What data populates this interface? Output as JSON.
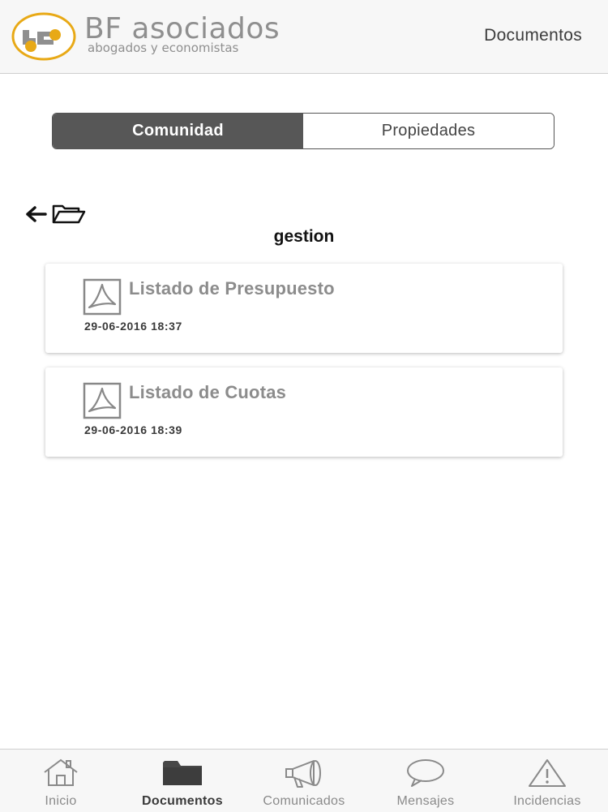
{
  "header": {
    "brand_name": "BF asociados",
    "brand_tagline": "abogados y economistas",
    "title": "Documentos"
  },
  "segmented": {
    "tabs": [
      {
        "label": "Comunidad",
        "active": true
      },
      {
        "label": "Propiedades",
        "active": false
      }
    ]
  },
  "folder": {
    "name": "gestion",
    "back_icon": "arrow-left-icon",
    "folder_icon": "folder-open-icon"
  },
  "documents": [
    {
      "title": "Listado de Presupuesto",
      "date": "29-06-2016 18:37",
      "icon": "pdf-icon"
    },
    {
      "title": "Listado de Cuotas",
      "date": "29-06-2016 18:39",
      "icon": "pdf-icon"
    }
  ],
  "tabbar": {
    "items": [
      {
        "label": "Inicio",
        "icon": "home-icon",
        "active": false
      },
      {
        "label": "Documentos",
        "icon": "folder-icon",
        "active": true
      },
      {
        "label": "Comunicados",
        "icon": "megaphone-icon",
        "active": false
      },
      {
        "label": "Mensajes",
        "icon": "chat-bubble-icon",
        "active": false
      },
      {
        "label": "Incidencias",
        "icon": "warning-icon",
        "active": false
      }
    ]
  },
  "colors": {
    "brand_gold": "#E8A916",
    "brand_gray": "#8F8F8F",
    "segment_active": "#575757"
  }
}
